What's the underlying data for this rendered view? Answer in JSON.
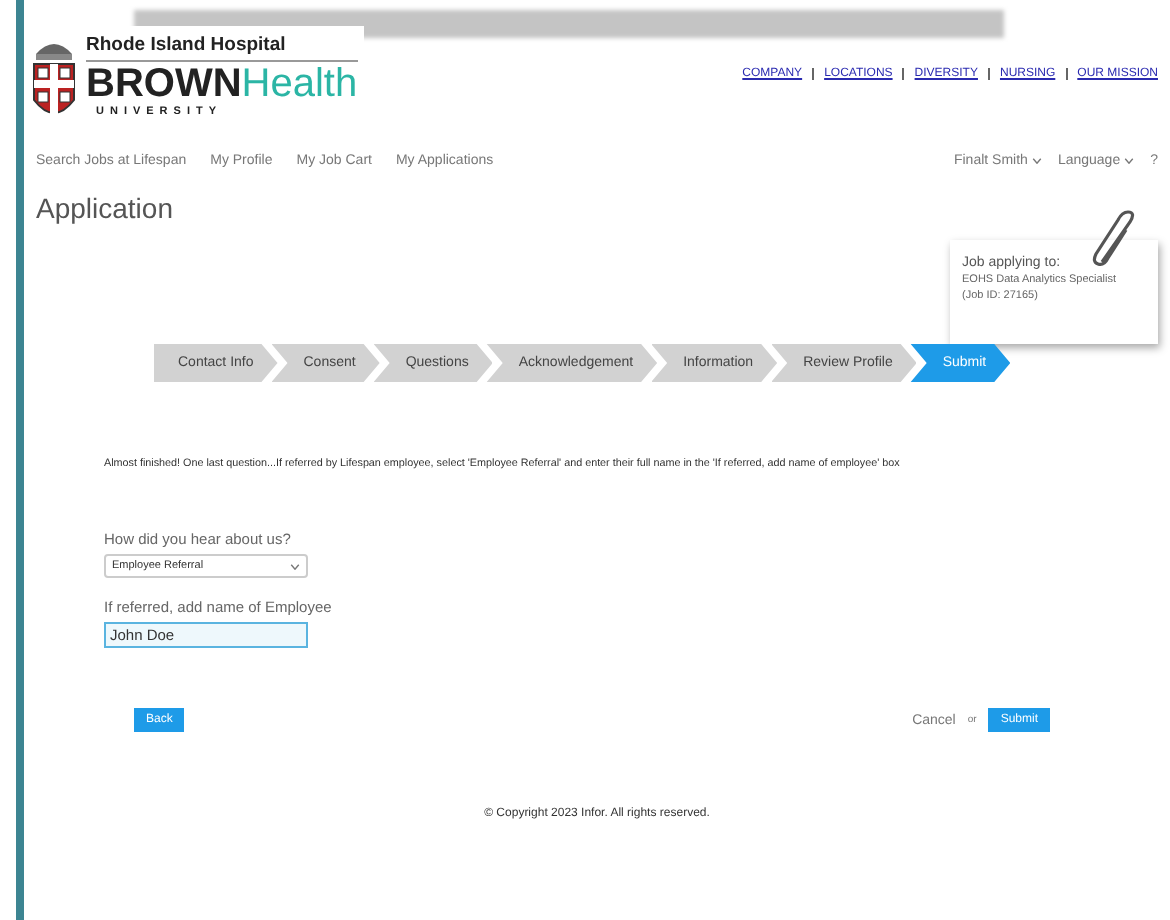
{
  "logo": {
    "hospital": "Rhode Island Hospital",
    "brand_main": "BROWN",
    "brand_accent": "Health",
    "university": "UNIVERSITY"
  },
  "top_links": [
    "COMPANY",
    "LOCATIONS",
    "DIVERSITY",
    "NURSING",
    "OUR MISSION"
  ],
  "nav": {
    "items": [
      "Search Jobs at Lifespan",
      "My Profile",
      "My Job Cart",
      "My Applications"
    ],
    "user": "Finalt Smith",
    "language": "Language",
    "help": "?"
  },
  "page_title": "Application",
  "job_card": {
    "heading": "Job applying to:",
    "job": "EOHS Data Analytics Specialist",
    "job_id": "(Job ID: 27165)"
  },
  "steps": [
    {
      "label": "Contact Info",
      "selected": false
    },
    {
      "label": "Consent",
      "selected": false
    },
    {
      "label": "Questions",
      "selected": false
    },
    {
      "label": "Acknowledgement",
      "selected": false
    },
    {
      "label": "Information",
      "selected": false
    },
    {
      "label": "Review Profile",
      "selected": false
    },
    {
      "label": "Submit",
      "selected": true
    }
  ],
  "instruction": "Almost finished! One last question...If referred by Lifespan employee, select 'Employee Referral' and enter their full name in the 'If referred, add name of employee' box",
  "fields": [
    {
      "kind": "select",
      "label": "How did you hear about us?",
      "value": "Employee Referral"
    },
    {
      "kind": "text",
      "label": "If referred, add name of Employee",
      "value": "John Doe",
      "focused": true
    }
  ],
  "back": "Back",
  "cancel": "Cancel",
  "or": "or",
  "submit": "Submit",
  "footer": "© Copyright 2023  Infor. All rights reserved."
}
